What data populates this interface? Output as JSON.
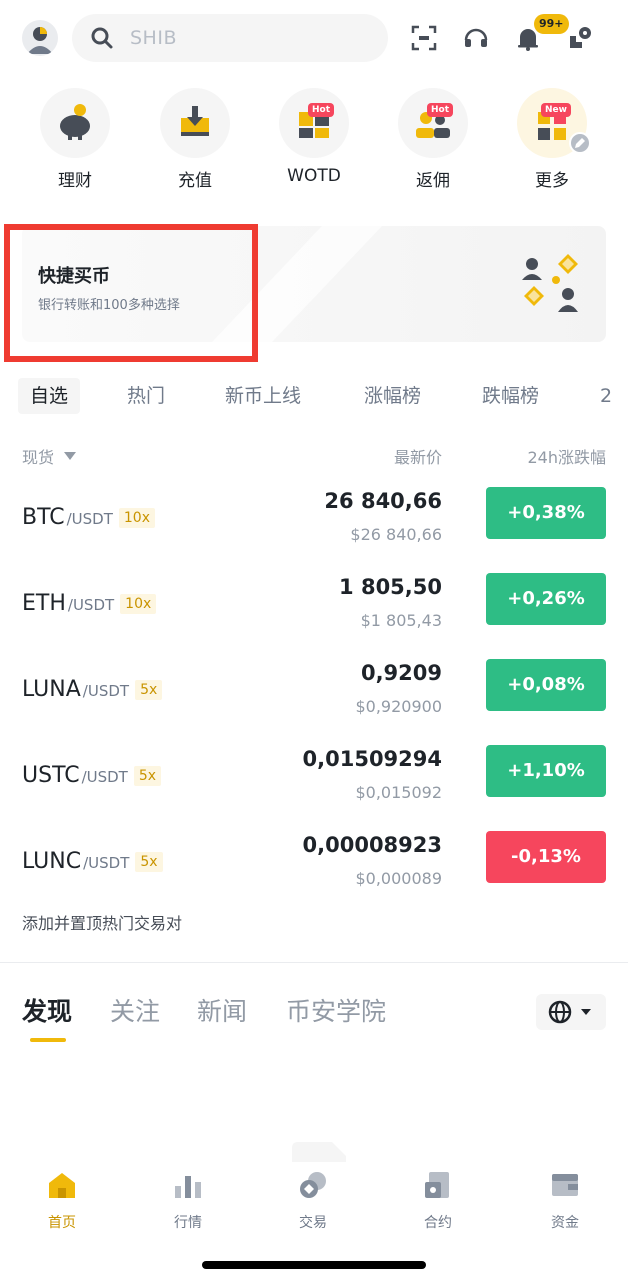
{
  "colors": {
    "accent": "#f0b90b",
    "up": "#2ebd85",
    "down": "#f6465d",
    "highlight": "#ef3b31"
  },
  "header": {
    "search_placeholder": "SHIB",
    "notification_badge": "99+",
    "icons": [
      "avatar-icon",
      "search-icon",
      "scan-icon",
      "headset-icon",
      "bell-icon",
      "share-icon"
    ]
  },
  "quick_links": [
    {
      "label": "理财",
      "icon": "piggy-bank-icon",
      "tag": ""
    },
    {
      "label": "充值",
      "icon": "deposit-icon",
      "tag": ""
    },
    {
      "label": "WOTD",
      "icon": "word-puzzle-icon",
      "tag": "Hot"
    },
    {
      "label": "返佣",
      "icon": "referral-icon",
      "tag": "Hot"
    },
    {
      "label": "更多",
      "icon": "more-icon",
      "tag": "New"
    }
  ],
  "banner": {
    "title": "快捷买币",
    "subtitle": "银行转账和100多种选择"
  },
  "market_tabs": [
    "自选",
    "热门",
    "新币上线",
    "涨幅榜",
    "跌幅榜",
    "2"
  ],
  "columns": {
    "type": "现货",
    "price": "最新价",
    "change": "24h涨跌幅"
  },
  "markets": [
    {
      "base": "BTC",
      "quote": "/USDT",
      "leverage": "10x",
      "price": "26 840,66",
      "fiat": "$26 840,66",
      "change": "+0,38%",
      "direction": "up"
    },
    {
      "base": "ETH",
      "quote": "/USDT",
      "leverage": "10x",
      "price": "1 805,50",
      "fiat": "$1 805,43",
      "change": "+0,26%",
      "direction": "up"
    },
    {
      "base": "LUNA",
      "quote": "/USDT",
      "leverage": "5x",
      "price": "0,9209",
      "fiat": "$0,920900",
      "change": "+0,08%",
      "direction": "up"
    },
    {
      "base": "USTC",
      "quote": "/USDT",
      "leverage": "5x",
      "price": "0,01509294",
      "fiat": "$0,015092",
      "change": "+1,10%",
      "direction": "up"
    },
    {
      "base": "LUNC",
      "quote": "/USDT",
      "leverage": "5x",
      "price": "0,00008923",
      "fiat": "$0,000089",
      "change": "-0,13%",
      "direction": "down"
    }
  ],
  "add_pair_label": "添加并置顶热门交易对",
  "discover_tabs": [
    "发现",
    "关注",
    "新闻",
    "币安学院"
  ],
  "bottom_nav": [
    {
      "label": "首页",
      "icon": "home-icon",
      "active": true
    },
    {
      "label": "行情",
      "icon": "markets-icon",
      "active": false
    },
    {
      "label": "交易",
      "icon": "trade-icon",
      "active": false
    },
    {
      "label": "合约",
      "icon": "futures-icon",
      "active": false
    },
    {
      "label": "资金",
      "icon": "wallet-icon",
      "active": false
    }
  ]
}
